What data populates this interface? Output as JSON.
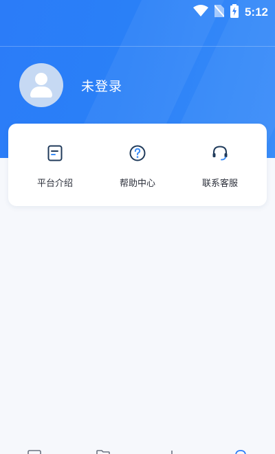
{
  "status_bar": {
    "time": "5:12",
    "icons": [
      "wifi-icon",
      "no-sim-icon",
      "battery-charging-icon"
    ]
  },
  "profile": {
    "username": "未登录",
    "avatar": "default-avatar-icon"
  },
  "menu": {
    "items": [
      {
        "label": "平台介绍",
        "icon": "document-icon"
      },
      {
        "label": "帮助中心",
        "icon": "help-circle-icon"
      },
      {
        "label": "联系客服",
        "icon": "headset-icon"
      }
    ]
  },
  "tab_bar": {
    "icons": [
      "home-icon",
      "folder-icon",
      "chart-icon",
      "profile-icon"
    ]
  },
  "colors": {
    "header": "#2b7cf8",
    "background": "#f6f8fc",
    "icon": "#1f3a5a"
  }
}
